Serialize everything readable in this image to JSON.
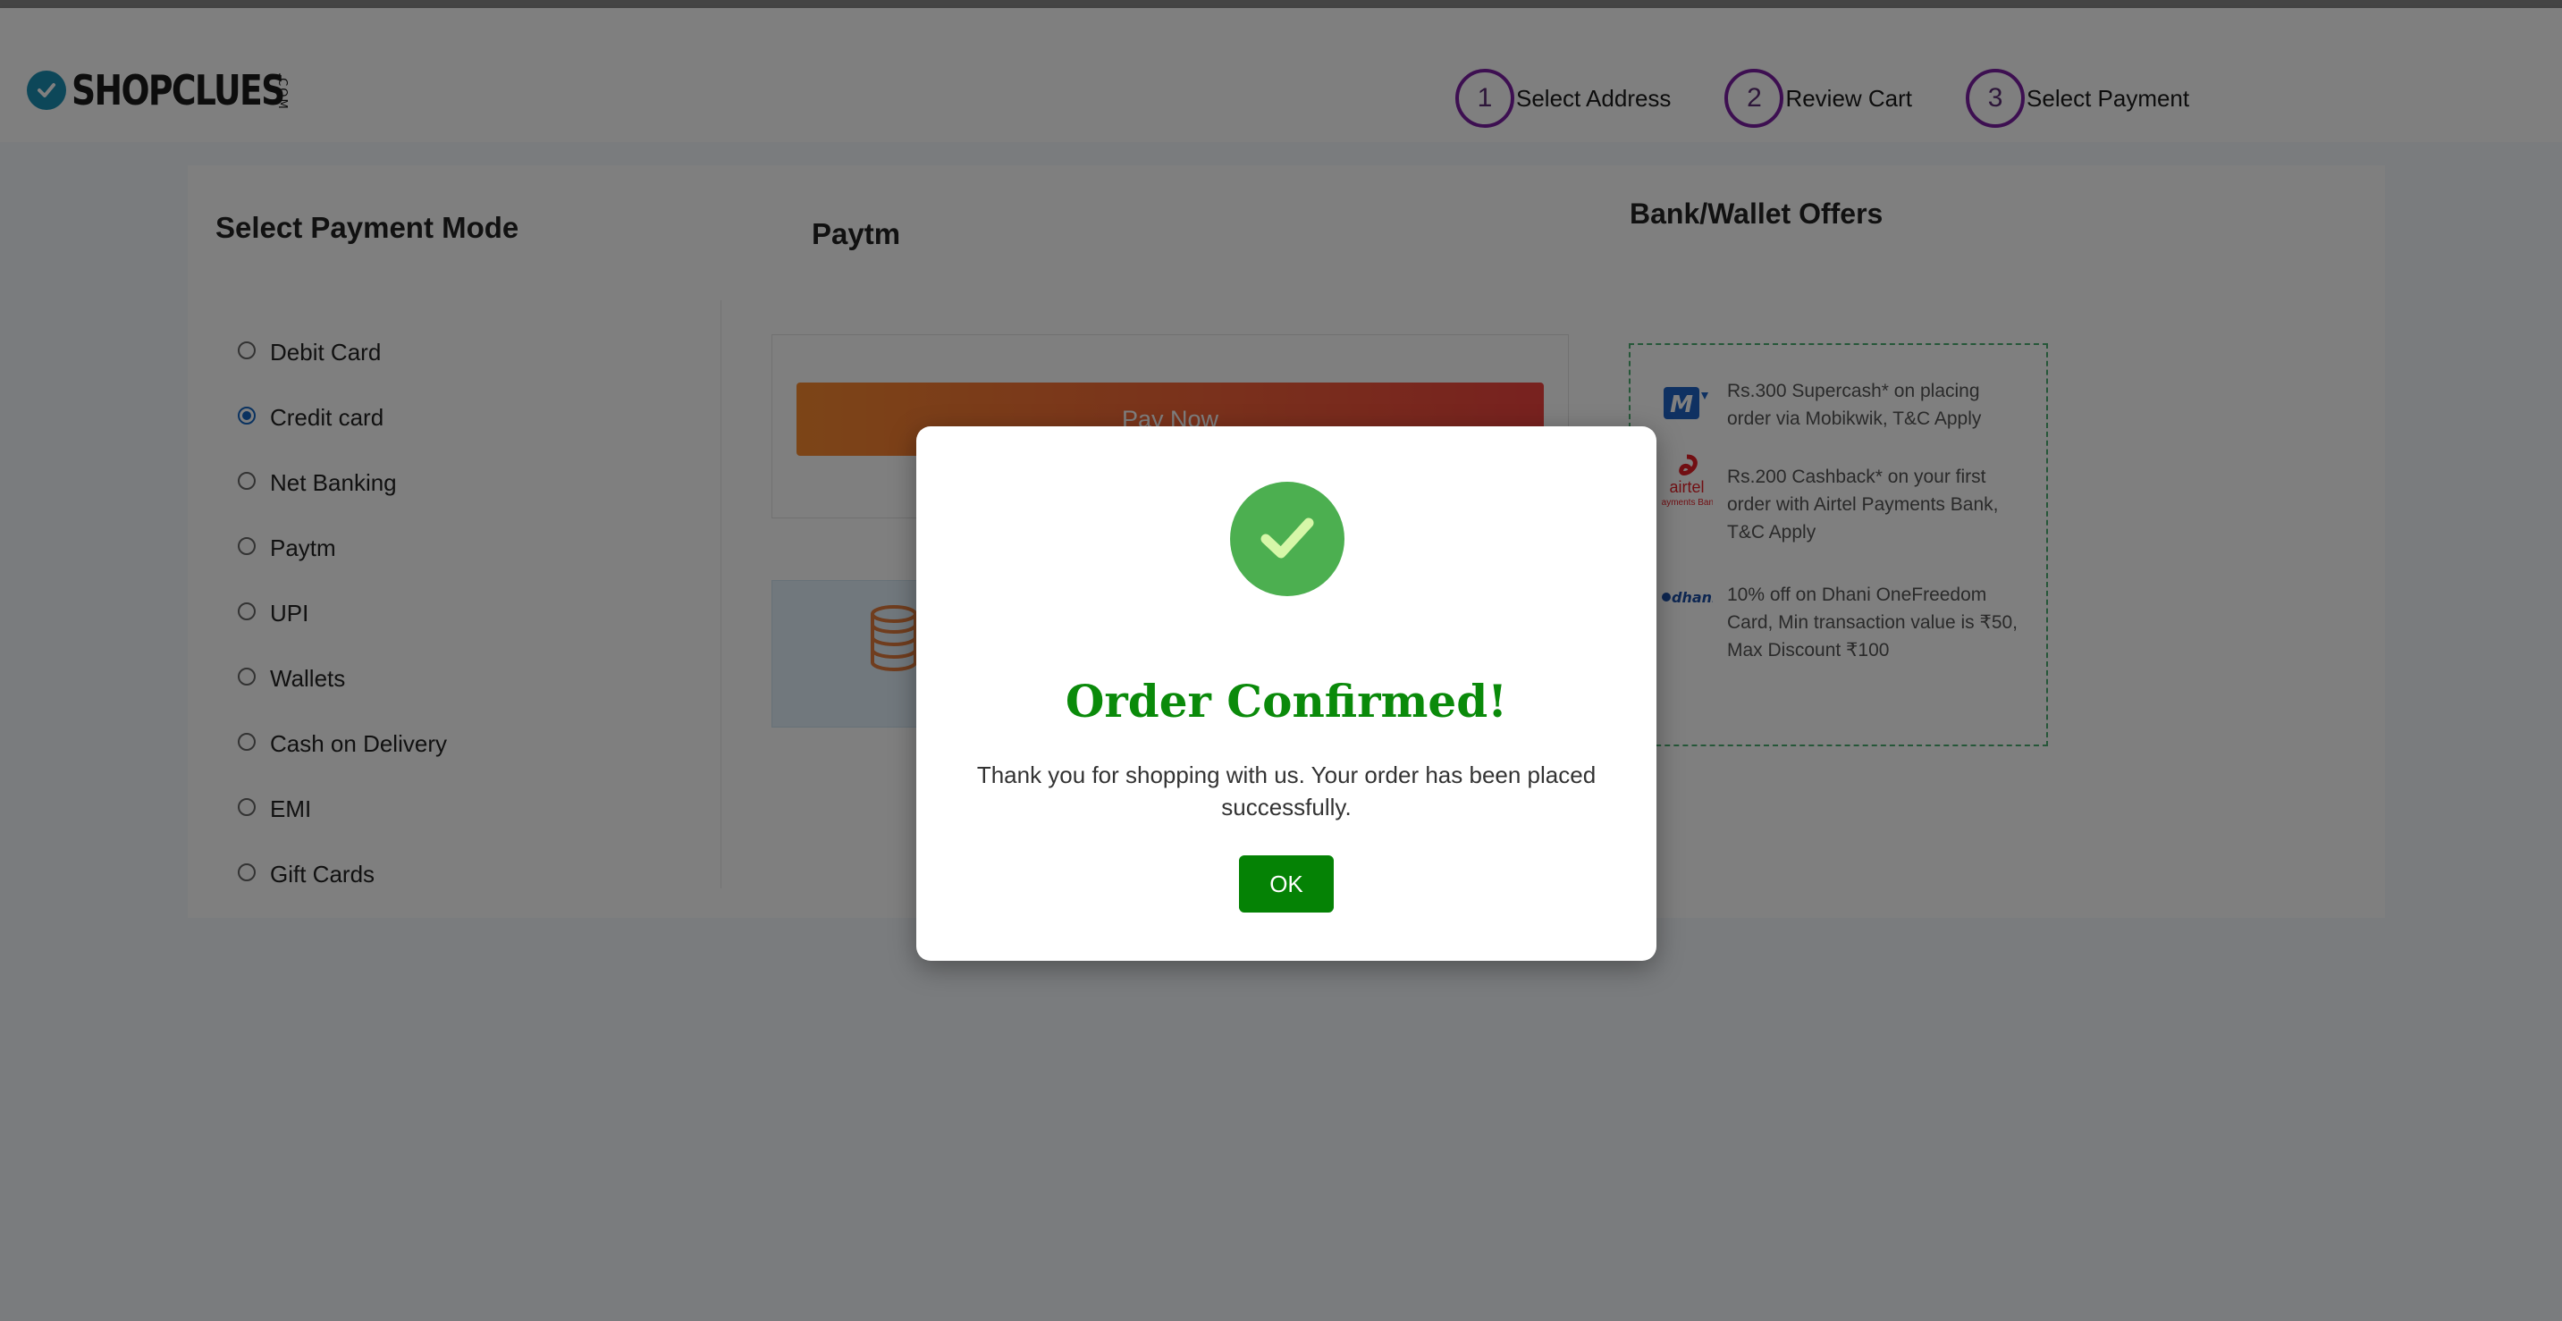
{
  "header": {
    "logo_text": "SHOPCLUES",
    "logo_suffix": ".COM",
    "steps": [
      {
        "number": "1",
        "label": "Select Address"
      },
      {
        "number": "2",
        "label": "Review Cart"
      },
      {
        "number": "3",
        "label": "Select Payment"
      }
    ]
  },
  "payment_modes": {
    "title": "Select Payment Mode",
    "selected": "Credit card",
    "options": [
      "Debit Card",
      "Credit card",
      "Net Banking",
      "Paytm",
      "UPI",
      "Wallets",
      "Cash on Delivery",
      "EMI",
      "Gift Cards"
    ]
  },
  "paytm": {
    "title": "Paytm",
    "pay_button_label": "Pay Now"
  },
  "offers": {
    "title": "Bank/Wallet Offers",
    "items": [
      {
        "logo": "mobikwik-logo",
        "logo_text": "M",
        "text": "Rs.300 Supercash* on placing order via Mobikwik, T&C Apply"
      },
      {
        "logo": "airtel-payments-bank-logo",
        "logo_text": "airtel",
        "logo_subtext": "Payments Bank",
        "text": "Rs.200 Cashback* on your first order with Airtel Payments Bank, T&C Apply"
      },
      {
        "logo": "dhani-logo",
        "logo_text": "dhani",
        "text": "10% off on Dhani OneFreedom Card, Min transaction value is ₹50, Max Discount ₹100"
      }
    ]
  },
  "modal": {
    "icon": "check-icon",
    "title": "Order Confirmed!",
    "message": "Thank you for shopping with us. Your order has been placed successfully.",
    "ok_label": "OK"
  },
  "colors": {
    "accent_purple": "#7b1fa2",
    "success_green": "#4caf50",
    "title_green": "#0a8a0a",
    "ok_button": "#058205",
    "pay_gradient_start": "#f98a2f",
    "pay_gradient_end": "#f0433f"
  }
}
